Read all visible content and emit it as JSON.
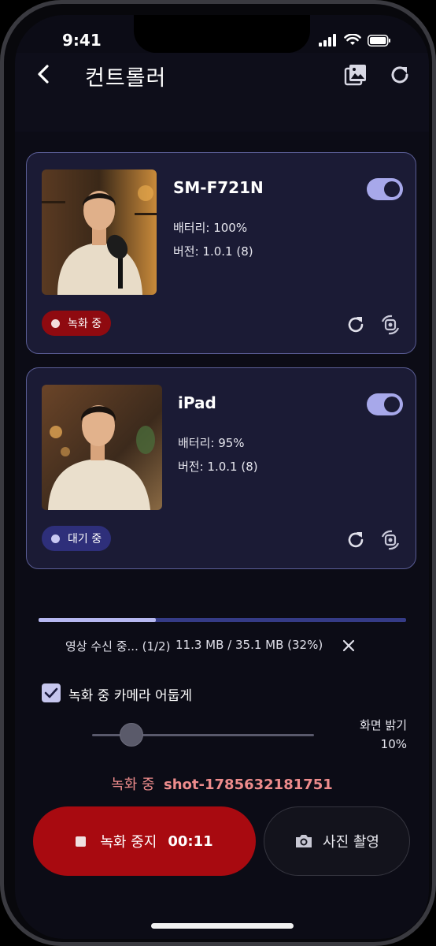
{
  "status": {
    "time": "9:41"
  },
  "header": {
    "title": "컨트롤러"
  },
  "devices": [
    {
      "name": "SM-F721N",
      "battery": "배터리: 100%",
      "version": "버전: 1.0.1 (8)",
      "status": "녹화 중",
      "toggle_on": true
    },
    {
      "name": "iPad",
      "battery": "배터리: 95%",
      "version": "버전: 1.0.1 (8)",
      "status": "대기 중",
      "toggle_on": true
    }
  ],
  "receive": {
    "label": "영상 수신 중... (1/2)",
    "size": "11.3 MB / 35.1 MB (32%)",
    "progress": 0.32
  },
  "dim_camera": {
    "label": "녹화 중 카메라 어둡게",
    "checked": true
  },
  "brightness": {
    "label": "화면 밝기",
    "value": "10%",
    "level": 0.1
  },
  "recording": {
    "prefix": "녹화 중",
    "shot": "shot-1785632181751"
  },
  "actions": {
    "stop_label": "녹화 중지",
    "timer": "00:11",
    "photo_label": "사진 촬영"
  },
  "colors": {
    "accent": "#a7a8ea",
    "record": "#a80a10",
    "background": "#0c0c16"
  }
}
